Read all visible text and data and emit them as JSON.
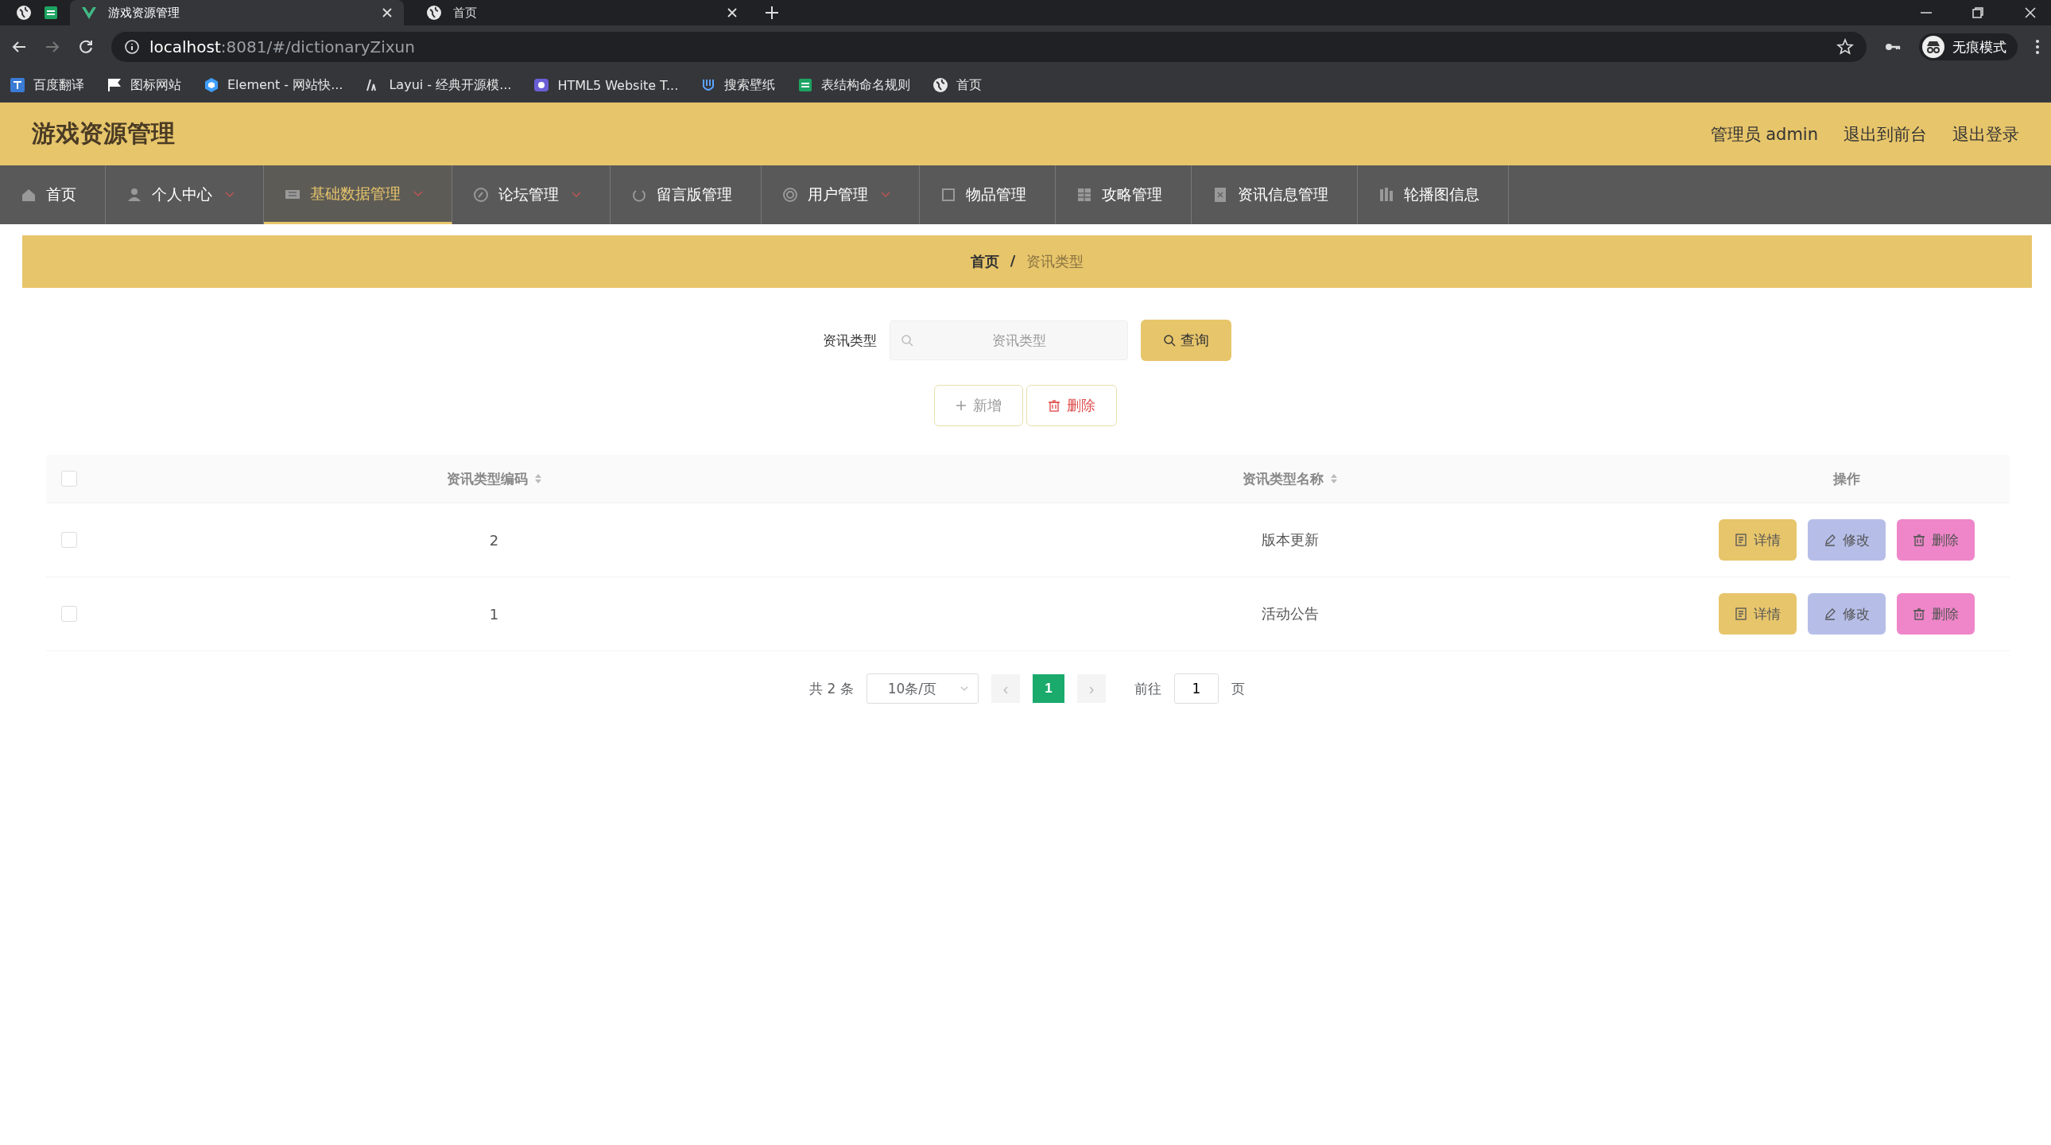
{
  "browser": {
    "tabs": [
      {
        "title": "游戏资源管理",
        "selected": true
      },
      {
        "title": "首页",
        "selected": false
      }
    ],
    "url_host": "localhost",
    "url_path": ":8081/#/dictionaryZixun",
    "bookmarks": [
      {
        "label": "百度翻译"
      },
      {
        "label": "图标网站"
      },
      {
        "label": "Element - 网站快..."
      },
      {
        "label": "Layui - 经典开源模..."
      },
      {
        "label": "HTML5 Website T..."
      },
      {
        "label": "搜索壁纸"
      },
      {
        "label": "表结构命名规则"
      },
      {
        "label": "首页"
      }
    ],
    "profile": "无痕模式"
  },
  "header": {
    "title": "游戏资源管理",
    "links": [
      "管理员 admin",
      "退出到前台",
      "退出登录"
    ]
  },
  "nav": {
    "items": [
      {
        "label": "首页",
        "selected": false,
        "caret": false
      },
      {
        "label": "个人中心",
        "selected": false,
        "caret": true
      },
      {
        "label": "基础数据管理",
        "selected": true,
        "caret": true
      },
      {
        "label": "论坛管理",
        "selected": false,
        "caret": true
      },
      {
        "label": "留言版管理",
        "selected": false,
        "caret": false
      },
      {
        "label": "用户管理",
        "selected": false,
        "caret": true
      },
      {
        "label": "物品管理",
        "selected": false,
        "caret": false
      },
      {
        "label": "攻略管理",
        "selected": false,
        "caret": false
      },
      {
        "label": "资讯信息管理",
        "selected": false,
        "caret": false
      },
      {
        "label": "轮播图信息",
        "selected": false,
        "caret": false
      }
    ]
  },
  "breadcrumb": {
    "separator": "/",
    "items": [
      {
        "label": "首页",
        "current": false
      },
      {
        "label": "资讯类型",
        "current": true
      }
    ]
  },
  "search": {
    "label": "资讯类型",
    "placeholder": "资讯类型",
    "button": "查询"
  },
  "actions": [
    {
      "label": "新增",
      "kind": "add"
    },
    {
      "label": "删除",
      "kind": "delete"
    }
  ],
  "table": {
    "header_checked": false,
    "columns": [
      {
        "label": "资讯类型编码",
        "sortable": true
      },
      {
        "label": "资讯类型名称",
        "sortable": true
      },
      {
        "label": "操作",
        "sortable": false
      }
    ],
    "rows": [
      {
        "checked": false,
        "code": "2",
        "name": "版本更新",
        "buttons": [
          {
            "label": "详情",
            "kind": "detail"
          },
          {
            "label": "修改",
            "kind": "edit"
          },
          {
            "label": "删除",
            "kind": "delete"
          }
        ]
      },
      {
        "checked": false,
        "code": "1",
        "name": "活动公告",
        "buttons": [
          {
            "label": "详情",
            "kind": "detail"
          },
          {
            "label": "修改",
            "kind": "edit"
          },
          {
            "label": "删除",
            "kind": "delete"
          }
        ]
      }
    ]
  },
  "pagination": {
    "total": "共 2 条",
    "page_size": "10条/页",
    "prev": "‹",
    "pages": [
      {
        "label": "1",
        "selected": true
      }
    ],
    "next": "›",
    "goto_label": "前往",
    "goto_value": "1",
    "goto_suffix": "页"
  }
}
